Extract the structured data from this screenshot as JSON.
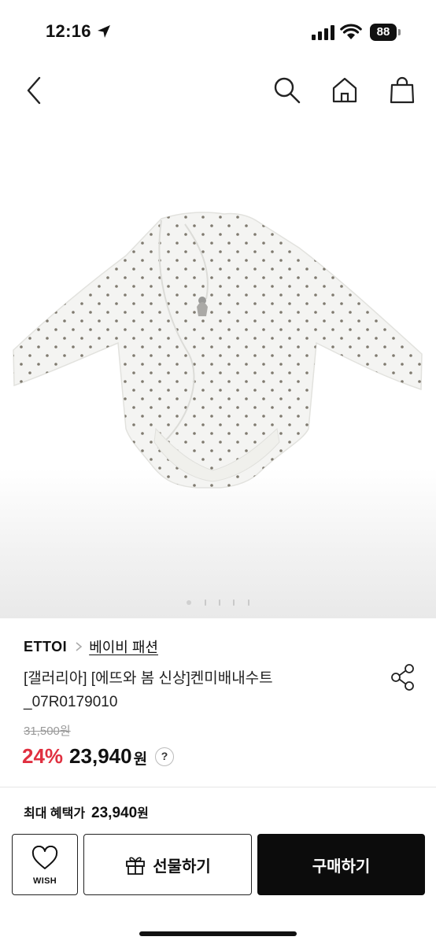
{
  "status_bar": {
    "time": "12:16",
    "battery": "88"
  },
  "product": {
    "brand": "ETTOI",
    "category": "베이비 패션",
    "title_line1": "[갤러리아] [에뜨와 봄 신상]켄미배내수트",
    "title_line2": "_07R0179010",
    "original_price": "31,500원",
    "discount": "24%",
    "sale_price": "23,940",
    "currency": "원",
    "help_symbol": "?",
    "max_benefit_label": "최대 혜택가",
    "max_benefit_price": "23,940",
    "max_benefit_currency": "원"
  },
  "gallery": {
    "current_index": 1,
    "total": 5
  },
  "bottom_bar": {
    "wish_label": "WISH",
    "gift_label": "선물하기",
    "buy_label": "구매하기"
  },
  "colors": {
    "accent_discount": "#e03040",
    "buy_button": "#0c0c0c"
  },
  "icons": [
    "location-arrow-icon",
    "signal-icon",
    "wifi-icon",
    "back-chevron-icon",
    "search-icon",
    "home-icon",
    "shopping-bag-icon",
    "chevron-right-icon",
    "share-icon",
    "heart-icon",
    "gift-icon"
  ]
}
